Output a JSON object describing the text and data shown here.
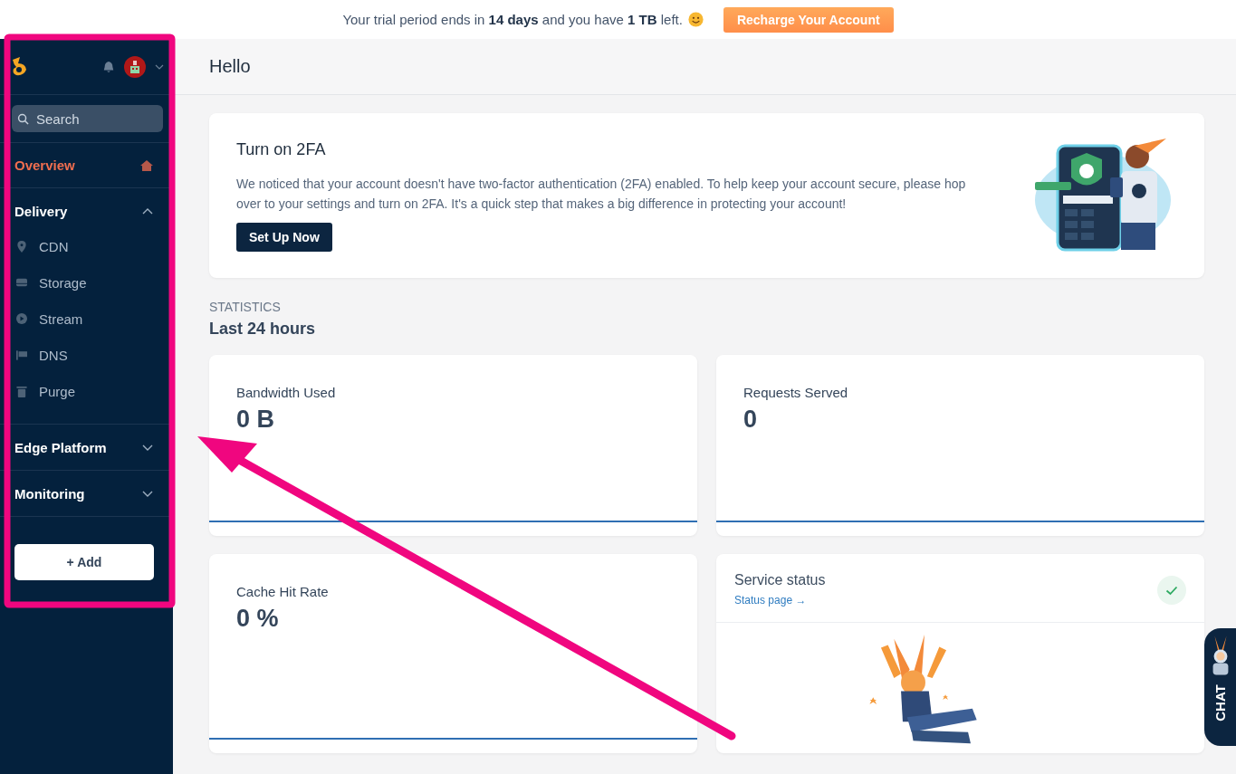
{
  "banner": {
    "text": "Your trial period ends in **14 days** and you have **1 TB** left.",
    "button": "Recharge Your Account"
  },
  "sidebar": {
    "search": {
      "placeholder": "Search"
    },
    "items": [
      {
        "label": "Overview",
        "kind": "link",
        "selected": true
      },
      {
        "label": "Delivery",
        "kind": "group",
        "expanded": true,
        "children": [
          {
            "label": "CDN",
            "selected": false
          },
          {
            "label": "Storage",
            "selected": false
          },
          {
            "label": "Stream",
            "selected": false
          },
          {
            "label": "DNS",
            "selected": false
          },
          {
            "label": "Purge",
            "selected": false
          }
        ]
      },
      {
        "label": "Edge Platform",
        "kind": "group",
        "expanded": false
      },
      {
        "label": "Monitoring",
        "kind": "group",
        "expanded": false
      }
    ],
    "add_button": "+ Add"
  },
  "header": {
    "title": "Hello"
  },
  "twofa": {
    "title": "Turn on 2FA",
    "text": "We noticed that your account doesn't have two-factor authentication (2FA) enabled. To help keep your account secure, please hop over to your settings and turn on 2FA. It's a quick step that makes a big difference in protecting your account!",
    "button": "Set Up Now"
  },
  "statistics": {
    "label": "STATISTICS",
    "period": "Last 24 hours",
    "cards": [
      {
        "kind": "metric",
        "title": "Bandwidth Used",
        "value": "0 B"
      },
      {
        "kind": "metric",
        "title": "Requests Served",
        "value": "0"
      },
      {
        "kind": "metric",
        "title": "Cache Hit Rate",
        "value": "0 %"
      },
      {
        "kind": "status",
        "title": "Service status",
        "link": "Status page →",
        "ok": true
      }
    ]
  },
  "chat": {
    "label": "CHAT"
  }
}
